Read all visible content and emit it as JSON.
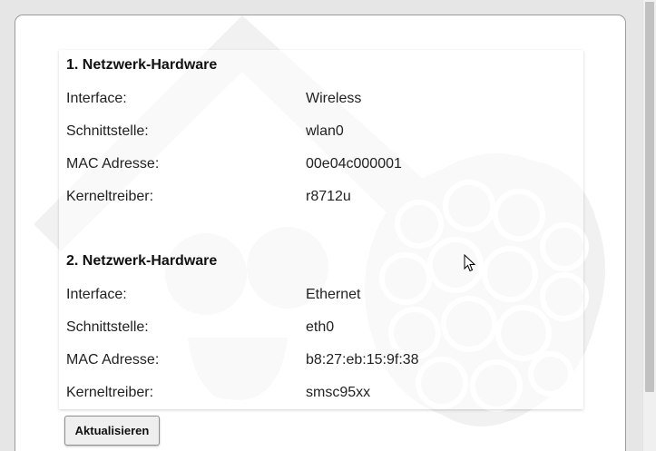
{
  "sections": [
    {
      "title": "1. Netzwerk-Hardware",
      "rows": [
        {
          "label": "Interface:",
          "value": "Wireless"
        },
        {
          "label": "Schnittstelle:",
          "value": "wlan0"
        },
        {
          "label": "MAC Adresse:",
          "value": "00e04c000001"
        },
        {
          "label": "Kerneltreiber:",
          "value": "r8712u"
        }
      ]
    },
    {
      "title": "2. Netzwerk-Hardware",
      "rows": [
        {
          "label": "Interface:",
          "value": "Ethernet"
        },
        {
          "label": "Schnittstelle:",
          "value": "eth0"
        },
        {
          "label": "MAC Adresse:",
          "value": "b8:27:eb:15:9f:38"
        },
        {
          "label": "Kerneltreiber:",
          "value": "smsc95xx"
        }
      ]
    }
  ],
  "actions": {
    "refresh_label": "Aktualisieren"
  },
  "icons": {
    "watermark": "raspberry-house-logo-icon",
    "cursor": "mouse-pointer-icon"
  }
}
